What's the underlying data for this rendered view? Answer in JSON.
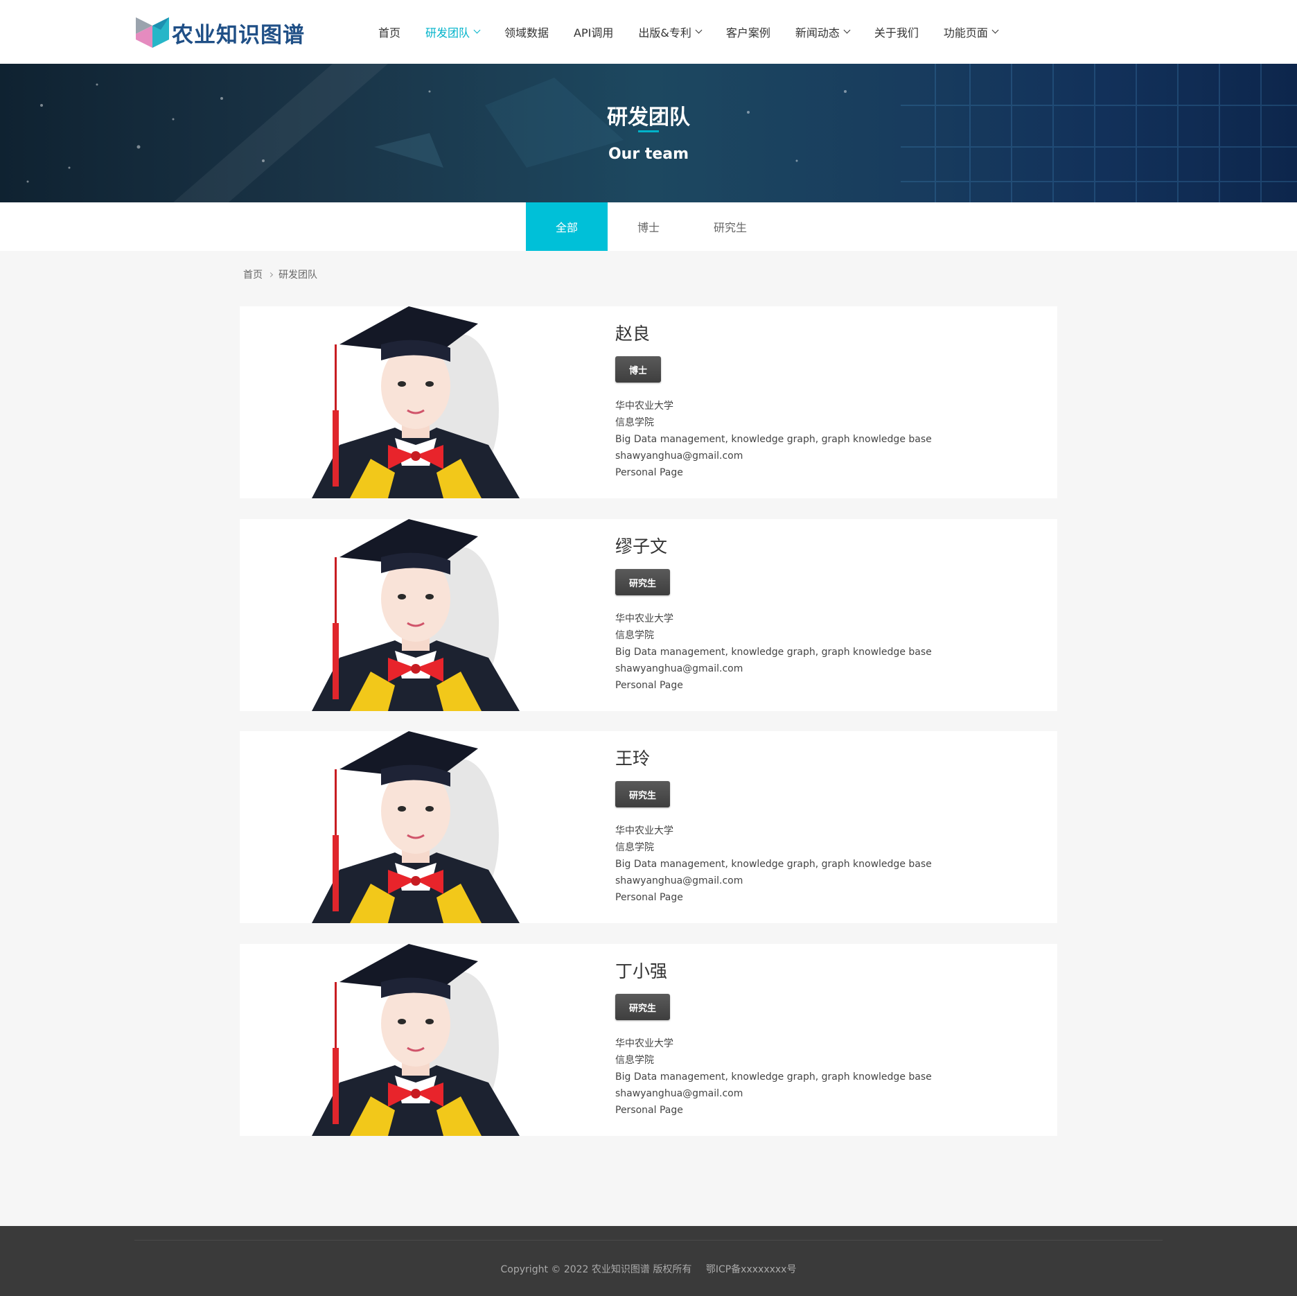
{
  "header": {
    "logo_text": "农业知识图谱",
    "nav": [
      {
        "label": "首页",
        "dropdown": false,
        "active": false
      },
      {
        "label": "研发团队",
        "dropdown": true,
        "active": true
      },
      {
        "label": "领域数据",
        "dropdown": false,
        "active": false
      },
      {
        "label": "API调用",
        "dropdown": false,
        "active": false
      },
      {
        "label": "出版&专利",
        "dropdown": true,
        "active": false
      },
      {
        "label": "客户案例",
        "dropdown": false,
        "active": false
      },
      {
        "label": "新闻动态",
        "dropdown": true,
        "active": false
      },
      {
        "label": "关于我们",
        "dropdown": false,
        "active": false
      },
      {
        "label": "功能页面",
        "dropdown": true,
        "active": false
      }
    ]
  },
  "banner": {
    "title": "研发团队",
    "subtitle": "Our team"
  },
  "tabs": [
    {
      "label": "全部",
      "active": true
    },
    {
      "label": "博士",
      "active": false
    },
    {
      "label": "研究生",
      "active": false
    }
  ],
  "breadcrumb": {
    "home": "首页",
    "current": "研发团队"
  },
  "members": [
    {
      "name": "赵良",
      "degree": "博士",
      "university": "华中农业大学",
      "college": "信息学院",
      "research": "Big Data management, knowledge graph, graph knowledge base",
      "email": "shawyanghua@gmail.com",
      "page_link": "Personal Page"
    },
    {
      "name": "缪子文",
      "degree": "研究生",
      "university": "华中农业大学",
      "college": "信息学院",
      "research": "Big Data management, knowledge graph, graph knowledge base",
      "email": "shawyanghua@gmail.com",
      "page_link": "Personal Page"
    },
    {
      "name": "王玲",
      "degree": "研究生",
      "university": "华中农业大学",
      "college": "信息学院",
      "research": "Big Data management, knowledge graph, graph knowledge base",
      "email": "shawyanghua@gmail.com",
      "page_link": "Personal Page"
    },
    {
      "name": "丁小强",
      "degree": "研究生",
      "university": "华中农业大学",
      "college": "信息学院",
      "research": "Big Data management, knowledge graph, graph knowledge base",
      "email": "shawyanghua@gmail.com",
      "page_link": "Personal Page"
    }
  ],
  "footer": {
    "copyright": "Copyright © 2022 农业知识图谱 版权所有",
    "icp": "鄂ICP备xxxxxxxx号"
  },
  "colors": {
    "accent": "#00b3ca",
    "tab_active": "#00c0d8",
    "logo": "#1f4f86",
    "footer_bg": "#3a3a3a"
  }
}
